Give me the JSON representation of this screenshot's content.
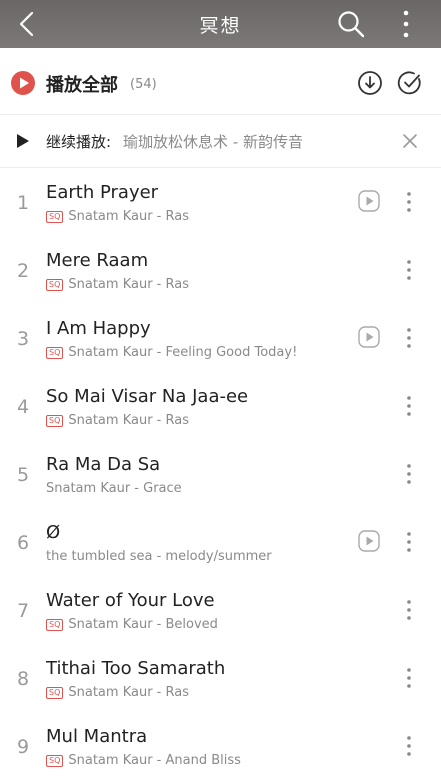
{
  "header": {
    "title": "冥想"
  },
  "play_all": {
    "label": "播放全部",
    "count": "(54)"
  },
  "resume": {
    "label": "继续播放:",
    "track": "瑜珈放松休息术 - 新韵传音"
  },
  "colors": {
    "accent": "#e0524c",
    "header_bg": "#716d6c"
  },
  "songs": [
    {
      "index": "1",
      "title": "Earth Prayer",
      "sq": "SQ",
      "artist_album": "Snatam Kaur - Ras",
      "has_sq": true,
      "has_mv": true
    },
    {
      "index": "2",
      "title": "Mere Raam",
      "sq": "SQ",
      "artist_album": "Snatam Kaur - Ras",
      "has_sq": true,
      "has_mv": false
    },
    {
      "index": "3",
      "title": "I Am Happy",
      "sq": "SQ",
      "artist_album": "Snatam Kaur - Feeling Good Today!",
      "has_sq": true,
      "has_mv": true
    },
    {
      "index": "4",
      "title": "So Mai Visar Na Jaa-ee",
      "sq": "SQ",
      "artist_album": "Snatam Kaur - Ras",
      "has_sq": true,
      "has_mv": false
    },
    {
      "index": "5",
      "title": "Ra Ma Da Sa",
      "sq": "",
      "artist_album": "Snatam Kaur - Grace",
      "has_sq": false,
      "has_mv": false
    },
    {
      "index": "6",
      "title": "Ø",
      "sq": "",
      "artist_album": "the tumbled sea - melody/summer",
      "has_sq": false,
      "has_mv": true
    },
    {
      "index": "7",
      "title": "Water of Your Love",
      "sq": "SQ",
      "artist_album": "Snatam Kaur - Beloved",
      "has_sq": true,
      "has_mv": false
    },
    {
      "index": "8",
      "title": "Tithai Too Samarath",
      "sq": "SQ",
      "artist_album": "Snatam Kaur - Ras",
      "has_sq": true,
      "has_mv": false
    },
    {
      "index": "9",
      "title": "Mul Mantra",
      "sq": "SQ",
      "artist_album": "Snatam Kaur - Anand Bliss",
      "has_sq": true,
      "has_mv": false
    }
  ]
}
